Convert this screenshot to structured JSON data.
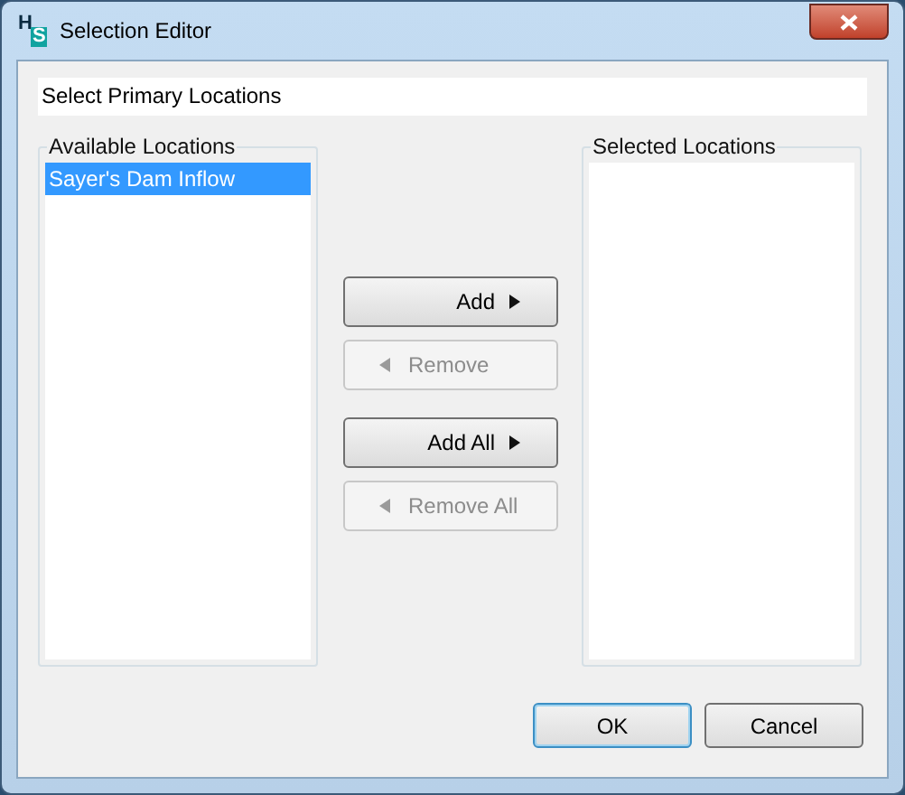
{
  "window": {
    "title": "Selection Editor",
    "logo_letters": [
      "H",
      "S"
    ]
  },
  "header": {
    "value": "Select Primary Locations"
  },
  "available": {
    "title": "Available Locations",
    "items": [
      {
        "label": "Sayer's Dam Inflow",
        "selected": true
      }
    ]
  },
  "transfer_buttons": [
    {
      "label": "Add",
      "kind": "forward",
      "disabled": false
    },
    {
      "label": "Remove",
      "kind": "back",
      "disabled": true
    },
    {
      "label": "Add All",
      "kind": "forward",
      "disabled": false
    },
    {
      "label": "Remove All",
      "kind": "back",
      "disabled": true
    }
  ],
  "selected": {
    "title": "Selected Locations"
  },
  "footer_buttons": [
    {
      "label": "OK",
      "default": true
    },
    {
      "label": "Cancel",
      "default": false
    }
  ]
}
